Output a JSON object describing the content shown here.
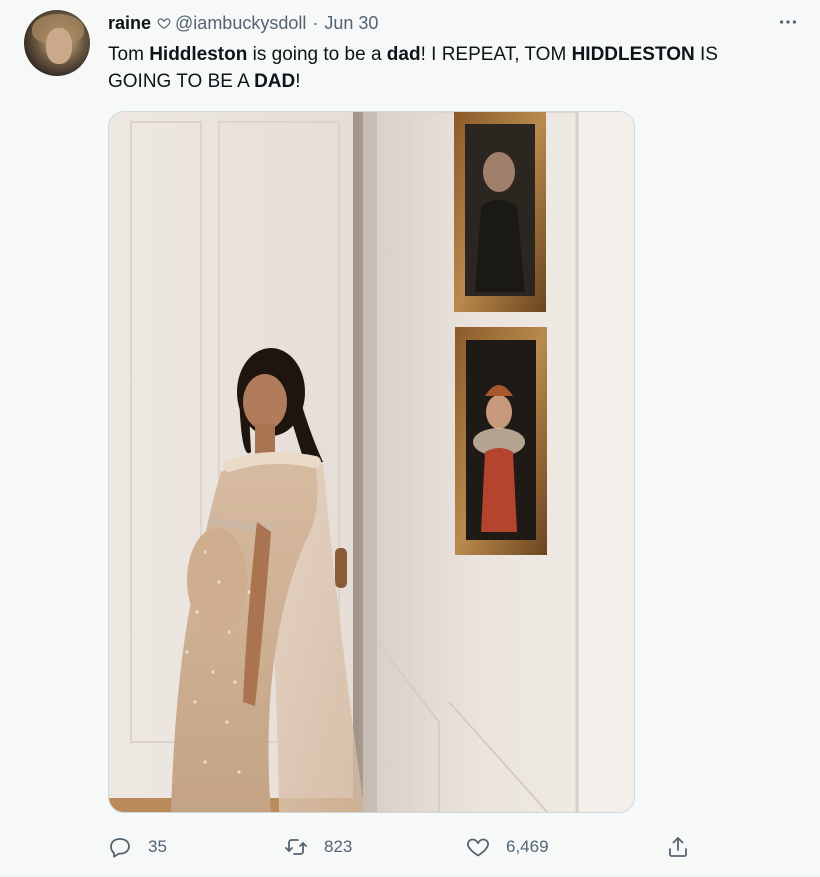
{
  "tweet": {
    "display_name": "raine",
    "handle": "@iambuckysdoll",
    "separator": "·",
    "date": "Jun 30",
    "text_parts": [
      {
        "text": "Tom ",
        "bold": false
      },
      {
        "text": "Hiddleston",
        "bold": true
      },
      {
        "text": " is going to be a ",
        "bold": false
      },
      {
        "text": "dad",
        "bold": true
      },
      {
        "text": "! I REPEAT, TOM ",
        "bold": false
      },
      {
        "text": "HIDDLESTON",
        "bold": true
      },
      {
        "text": " IS GOING TO BE A ",
        "bold": false
      },
      {
        "text": "DAD",
        "bold": true
      },
      {
        "text": "!",
        "bold": false
      }
    ],
    "icons": {
      "name_badge": "heart-outline-icon",
      "more": "more-horizontal-icon",
      "reply": "reply-icon",
      "retweet": "retweet-icon",
      "like": "heart-icon",
      "share": "share-icon"
    }
  },
  "actions": {
    "reply_count": "35",
    "retweet_count": "823",
    "like_count": "6,469"
  },
  "colors": {
    "text": "#0f1419",
    "muted": "#536471",
    "background": "#f7f9f9"
  }
}
